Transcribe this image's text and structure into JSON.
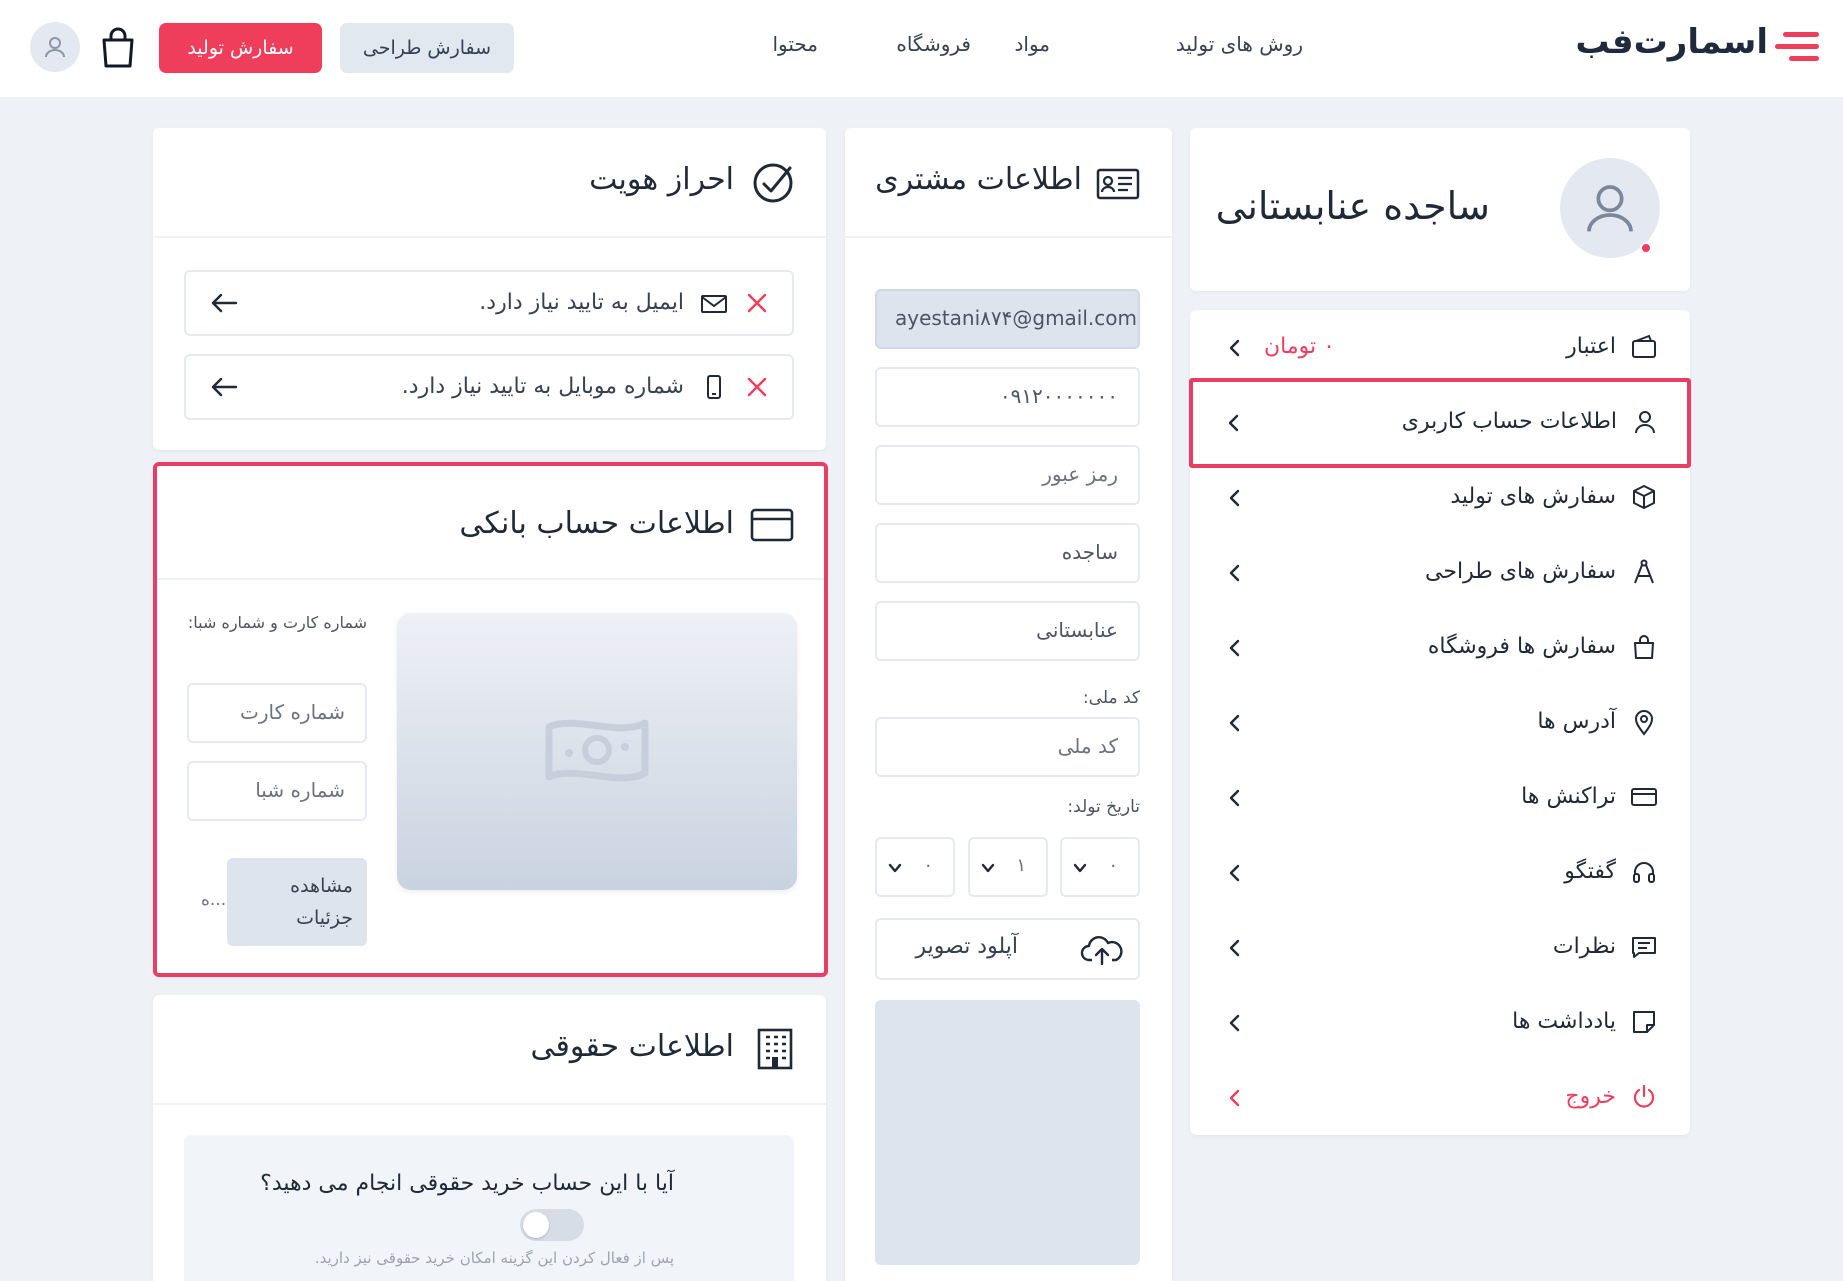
{
  "header": {
    "logo_text": "اسمارت‌فب",
    "nav": [
      "روش های تولید",
      "مواد",
      "فروشگاه",
      "محتوا"
    ],
    "design_order_label": "سفارش طراحی",
    "produce_order_label": "سفارش تولید"
  },
  "profile": {
    "name": "ساجده عنابستانی"
  },
  "menu": {
    "items": [
      {
        "label": "اعتبار",
        "icon": "wallet-icon",
        "value": "۰ تومان"
      },
      {
        "label": "اطلاعات حساب کاربری",
        "icon": "user-icon"
      },
      {
        "label": "سفارش های تولید",
        "icon": "box-icon"
      },
      {
        "label": "سفارش های طراحی",
        "icon": "compass-icon"
      },
      {
        "label": "سفارش ها فروشگاه",
        "icon": "shopping-bag-icon"
      },
      {
        "label": "آدرس ها",
        "icon": "location-icon"
      },
      {
        "label": "تراکنش ها",
        "icon": "card-icon"
      },
      {
        "label": "گفتگو",
        "icon": "headset-icon"
      },
      {
        "label": "نظرات",
        "icon": "comment-icon"
      },
      {
        "label": "یادداشت ها",
        "icon": "note-icon"
      },
      {
        "label": "خروج",
        "icon": "power-icon"
      }
    ]
  },
  "customer": {
    "title": "اطلاعات مشتری",
    "email": "ayestani۸۷۴@gmail.com",
    "phone": "۰۹۱۲۰۰۰۰۰۰۰",
    "password_placeholder": "رمز عبور",
    "first_name": "ساجده",
    "last_name": "عنابستانی",
    "national_code_label": "کد ملی:",
    "national_code_placeholder": "کد ملی",
    "birth_label": "تاریخ تولد:",
    "birth_day": "۰",
    "birth_month": "۱",
    "birth_year": "۰",
    "upload_label": "آپلود تصویر"
  },
  "identity": {
    "title": "احراز هویت",
    "email_text": "ایمیل به تایید نیاز دارد.",
    "mobile_text": "شماره موبایل به تایید نیاز دارد."
  },
  "bank": {
    "title": "اطلاعات حساب بانکی",
    "card_sheba_label": "شماره کارت و شماره شبا:",
    "card_placeholder": "شماره کارت",
    "sheba_placeholder": "شماره شبا",
    "details_button": "مشاهده جزئیات",
    "ellipsis": "...ه"
  },
  "legal": {
    "title": "اطلاعات حقوقی",
    "question": "آیا با این حساب خرید حقوقی انجام می دهید؟",
    "hint": "پس از فعال کردن این گزینه امکان خرید حقوقی نیز دارید.",
    "toggle_on": false
  },
  "colors": {
    "accent": "#ef3e5c",
    "highlight": "#e83e63",
    "muted": "#dde4ee"
  }
}
